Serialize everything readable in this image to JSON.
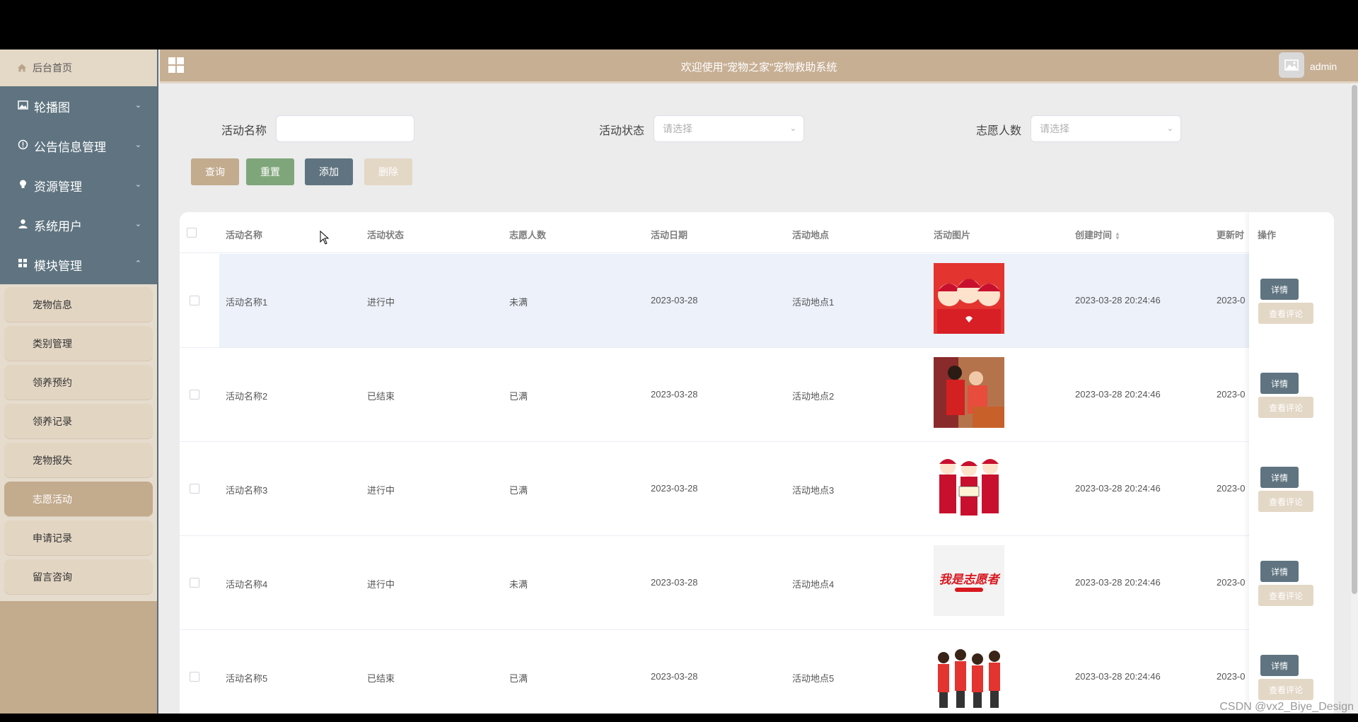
{
  "sidebar": {
    "home_label": "后台首页",
    "groups": [
      {
        "label": "轮播图",
        "icon": "image-icon"
      },
      {
        "label": "公告信息管理",
        "icon": "info-icon"
      },
      {
        "label": "资源管理",
        "icon": "bulb-icon"
      },
      {
        "label": "系统用户",
        "icon": "user-icon"
      },
      {
        "label": "模块管理",
        "icon": "grid-icon"
      }
    ],
    "submenu": [
      "宠物信息",
      "类别管理",
      "领养预约",
      "领养记录",
      "宠物报失",
      "志愿活动",
      "申请记录",
      "留言咨询"
    ],
    "active_submenu": "志愿活动"
  },
  "header": {
    "title": "欢迎使用\"宠物之家\"宠物救助系统",
    "username": "admin"
  },
  "search": {
    "name_label": "活动名称",
    "name_value": "",
    "status_label": "活动状态",
    "status_placeholder": "请选择",
    "volunteers_label": "志愿人数",
    "volunteers_placeholder": "请选择"
  },
  "buttons": {
    "query": "查询",
    "reset": "重置",
    "add": "添加",
    "delete": "删除"
  },
  "colors": {
    "accent": "#c3ab8e",
    "nav": "#5f7480",
    "reset_green": "#7fa67a",
    "add_slate": "#5f7480",
    "delete_disabled": "#e3d7c6"
  },
  "table": {
    "columns": [
      "活动名称",
      "活动状态",
      "志愿人数",
      "活动日期",
      "活动地点",
      "活动图片",
      "创建时间",
      "更新时",
      "操作"
    ],
    "rows": [
      {
        "name": "活动名称1",
        "status": "进行中",
        "volunteers": "未满",
        "date": "2023-03-28",
        "location": "活动地点1",
        "created": "2023-03-28 20:24:46",
        "updated": "2023-0"
      },
      {
        "name": "活动名称2",
        "status": "已结束",
        "volunteers": "已满",
        "date": "2023-03-28",
        "location": "活动地点2",
        "created": "2023-03-28 20:24:46",
        "updated": "2023-0"
      },
      {
        "name": "活动名称3",
        "status": "进行中",
        "volunteers": "已满",
        "date": "2023-03-28",
        "location": "活动地点3",
        "created": "2023-03-28 20:24:46",
        "updated": "2023-0"
      },
      {
        "name": "活动名称4",
        "status": "进行中",
        "volunteers": "未满",
        "date": "2023-03-28",
        "location": "活动地点4",
        "created": "2023-03-28 20:24:46",
        "updated": "2023-0"
      },
      {
        "name": "活动名称5",
        "status": "已结束",
        "volunteers": "已满",
        "date": "2023-03-28",
        "location": "活动地点5",
        "created": "2023-03-28 20:24:46",
        "updated": "2023-0"
      }
    ],
    "detail_label": "详情",
    "comment_label": "查看评论",
    "image4_text": "我是志愿者"
  },
  "watermark": "CSDN @vx2_Biye_Design"
}
